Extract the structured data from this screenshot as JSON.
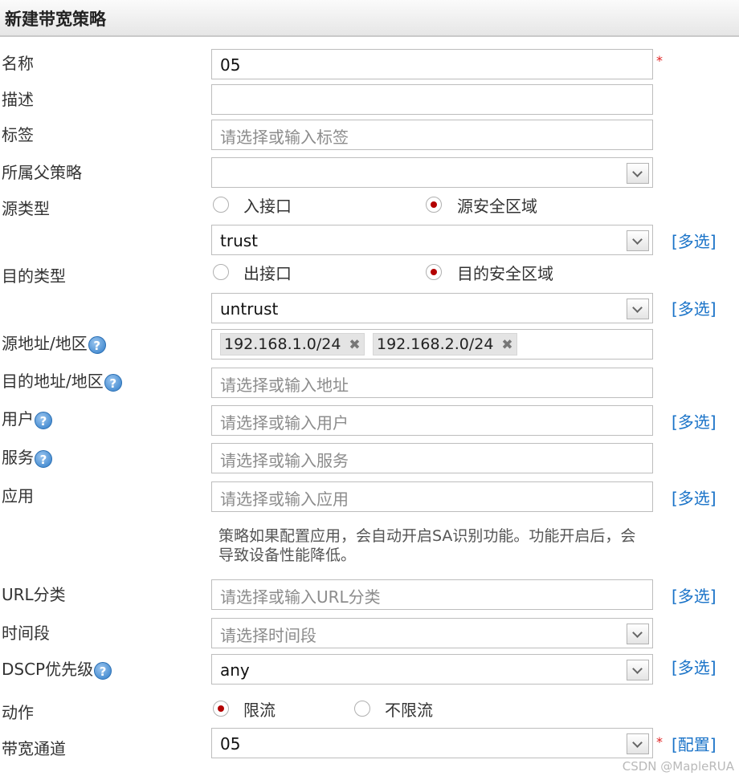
{
  "title": "新建带宽策略",
  "labels": {
    "name": "名称",
    "desc": "描述",
    "tag": "标签",
    "parent": "所属父策略",
    "src_type": "源类型",
    "dst_type": "目的类型",
    "src_addr": "源地址/地区",
    "dst_addr": "目的地址/地区",
    "user": "用户",
    "service": "服务",
    "app": "应用",
    "url": "URL分类",
    "time": "时间段",
    "dscp": "DSCP优先级",
    "action": "动作",
    "channel": "带宽通道"
  },
  "values": {
    "name": "05",
    "src_zone": "trust",
    "dst_zone": "untrust",
    "dscp": "any",
    "channel": "05"
  },
  "placeholders": {
    "tag": "请选择或输入标签",
    "dst_addr": "请选择或输入地址",
    "user": "请选择或输入用户",
    "service": "请选择或输入服务",
    "app": "请选择或输入应用",
    "url": "请选择或输入URL分类",
    "time": "请选择时间段"
  },
  "radios": {
    "src_iface": "入接口",
    "src_zone": "源安全区域",
    "dst_iface": "出接口",
    "dst_zone": "目的安全区域",
    "limit": "限流",
    "nolimit": "不限流"
  },
  "src_addr_tags": [
    "192.168.1.0/24",
    "192.168.2.0/24"
  ],
  "tag_remove": "✖",
  "links": {
    "multi": "[多选]",
    "config": "[配置]"
  },
  "required_mark": "*",
  "help_glyph": "?",
  "app_note": "策略如果配置应用，会自动开启SA识别功能。功能开启后，会导致设备性能降低。",
  "watermark": "CSDN @MapleRUA",
  "colors": {
    "link": "#1a73c8",
    "required": "#e02020",
    "radio_selected": "#b30000"
  }
}
